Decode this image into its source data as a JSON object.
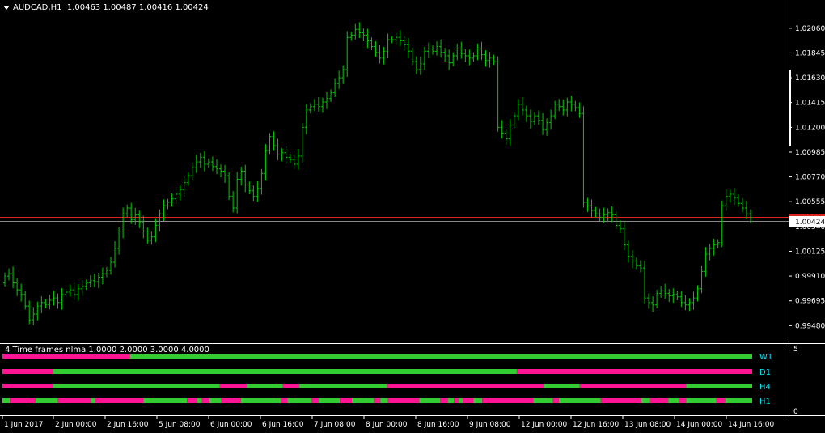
{
  "header": {
    "menu_icon": "triangle-down-icon",
    "symbol": "AUDCAD,H1",
    "ohlc": "1.00463 1.00487 1.00416 1.00424"
  },
  "indicator": {
    "title": "4 Time frames nlma 1.0000 2.0000 3.0000 4.0000",
    "scale_top": "5",
    "scale_bottom": "0",
    "rows": [
      {
        "label": "W1",
        "segments": [
          [
            "m",
            0,
            0.17
          ],
          [
            "g",
            0.17,
            1
          ]
        ]
      },
      {
        "label": "D1",
        "segments": [
          [
            "m",
            0,
            0.068
          ],
          [
            "g",
            0.068,
            0.686
          ],
          [
            "m",
            0.686,
            1
          ]
        ]
      },
      {
        "label": "H4",
        "segments": [
          [
            "m",
            0,
            0.068
          ],
          [
            "g",
            0.068,
            0.29
          ],
          [
            "m",
            0.29,
            0.326
          ],
          [
            "g",
            0.326,
            0.374
          ],
          [
            "m",
            0.374,
            0.396
          ],
          [
            "g",
            0.396,
            0.513
          ],
          [
            "m",
            0.513,
            0.722
          ],
          [
            "g",
            0.722,
            0.77
          ],
          [
            "m",
            0.77,
            0.912
          ],
          [
            "g",
            0.912,
            1
          ]
        ]
      },
      {
        "label": "H1",
        "segments": [
          [
            "g",
            0,
            0.01
          ],
          [
            "m",
            0.01,
            0.044
          ],
          [
            "g",
            0.044,
            0.074
          ],
          [
            "m",
            0.074,
            0.118
          ],
          [
            "g",
            0.118,
            0.124
          ],
          [
            "m",
            0.124,
            0.188
          ],
          [
            "g",
            0.188,
            0.246
          ],
          [
            "m",
            0.246,
            0.26
          ],
          [
            "g",
            0.26,
            0.266
          ],
          [
            "m",
            0.266,
            0.276
          ],
          [
            "g",
            0.276,
            0.292
          ],
          [
            "m",
            0.292,
            0.318
          ],
          [
            "g",
            0.318,
            0.372
          ],
          [
            "m",
            0.372,
            0.38
          ],
          [
            "g",
            0.38,
            0.412
          ],
          [
            "m",
            0.412,
            0.422
          ],
          [
            "g",
            0.422,
            0.45
          ],
          [
            "m",
            0.45,
            0.466
          ],
          [
            "g",
            0.466,
            0.496
          ],
          [
            "m",
            0.496,
            0.504
          ],
          [
            "g",
            0.504,
            0.514
          ],
          [
            "m",
            0.514,
            0.556
          ],
          [
            "g",
            0.556,
            0.584
          ],
          [
            "m",
            0.584,
            0.594
          ],
          [
            "g",
            0.594,
            0.602
          ],
          [
            "m",
            0.602,
            0.608
          ],
          [
            "g",
            0.608,
            0.614
          ],
          [
            "m",
            0.614,
            0.628
          ],
          [
            "g",
            0.628,
            0.64
          ],
          [
            "m",
            0.64,
            0.708
          ],
          [
            "g",
            0.708,
            0.734
          ],
          [
            "m",
            0.734,
            0.742
          ],
          [
            "g",
            0.742,
            0.798
          ],
          [
            "m",
            0.798,
            0.852
          ],
          [
            "g",
            0.852,
            0.864
          ],
          [
            "m",
            0.864,
            0.888
          ],
          [
            "g",
            0.888,
            0.902
          ],
          [
            "m",
            0.902,
            0.912
          ],
          [
            "g",
            0.912,
            0.952
          ],
          [
            "m",
            0.952,
            0.964
          ],
          [
            "g",
            0.964,
            1
          ]
        ]
      }
    ]
  },
  "chart_data": {
    "type": "bar",
    "title": "AUDCAD,H1",
    "ylim": [
      0.9937,
      1.0215
    ],
    "y_ticks": [
      "1.02060",
      "1.01845",
      "1.01630",
      "1.01415",
      "1.01200",
      "1.00985",
      "1.00770",
      "1.00555",
      "1.00340",
      "1.00125",
      "0.99910",
      "0.99695",
      "0.99480"
    ],
    "x_ticks": [
      "1 Jun 2017",
      "2 Jun 00:00",
      "2 Jun 16:00",
      "5 Jun 08:00",
      "6 Jun 00:00",
      "6 Jun 16:00",
      "7 Jun 08:00",
      "8 Jun 00:00",
      "8 Jun 16:00",
      "9 Jun 08:00",
      "12 Jun 00:00",
      "12 Jun 16:00",
      "13 Jun 08:00",
      "14 Jun 00:00",
      "14 Jun 16:00"
    ],
    "current_price": "1.00424",
    "series": [
      {
        "bar_color": "#00cc00",
        "close": [
          0.9991,
          0.9993,
          0.9985,
          0.9979,
          0.9975,
          0.9965,
          0.9953,
          0.9958,
          0.9965,
          0.9968,
          0.9966,
          0.997,
          0.9972,
          0.9968,
          0.9975,
          0.9977,
          0.9979,
          0.9975,
          0.998,
          0.9982,
          0.9985,
          0.9987,
          0.9986,
          0.999,
          0.9993,
          0.9996,
          1.0003,
          1.0015,
          1.003,
          1.0045,
          1.005,
          1.004,
          1.0044,
          1.0038,
          1.003,
          1.0022,
          1.0025,
          1.0035,
          1.0045,
          1.0052,
          1.0055,
          1.0058,
          1.0062,
          1.0066,
          1.0072,
          1.0078,
          1.0085,
          1.009,
          1.0094,
          1.0088,
          1.009,
          1.0086,
          1.0084,
          1.0082,
          1.0078,
          1.006,
          1.005,
          1.0075,
          1.0082,
          1.007,
          1.0065,
          1.006,
          1.0067,
          1.008,
          1.01,
          1.0112,
          1.0104,
          1.0096,
          1.0098,
          1.0094,
          1.0092,
          1.0088,
          1.0095,
          1.012,
          1.0135,
          1.0138,
          1.014,
          1.0138,
          1.0142,
          1.0145,
          1.015,
          1.0158,
          1.0163,
          1.017,
          1.0198,
          1.02,
          1.0205,
          1.0202,
          1.02,
          1.0195,
          1.019,
          1.0185,
          1.018,
          1.0186,
          1.0196,
          1.0196,
          1.0198,
          1.0195,
          1.0192,
          1.0186,
          1.0177,
          1.017,
          1.0175,
          1.0186,
          1.0188,
          1.0186,
          1.019,
          1.0185,
          1.0182,
          1.0176,
          1.0182,
          1.0188,
          1.0184,
          1.0182,
          1.018,
          1.0182,
          1.0188,
          1.0183,
          1.0178,
          1.018,
          1.0177,
          1.012,
          1.0115,
          1.011,
          1.0122,
          1.013,
          1.014,
          1.0135,
          1.013,
          1.0125,
          1.013,
          1.0126,
          1.0118,
          1.0124,
          1.013,
          1.014,
          1.0138,
          1.0135,
          1.0142,
          1.014,
          1.0137,
          1.0132,
          1.0055,
          1.0052,
          1.0048,
          1.0045,
          1.0042,
          1.0044,
          1.0046,
          1.0044,
          1.0035,
          1.0032,
          1.0018,
          1.0008,
          1.0004,
          1.0,
          0.9998,
          0.9972,
          0.9968,
          0.9966,
          0.9976,
          0.9978,
          0.9976,
          0.9974,
          0.9975,
          0.9973,
          0.9968,
          0.9966,
          0.9968,
          0.9972,
          0.998,
          0.9995,
          1.001,
          1.0015,
          1.0018,
          1.002,
          1.0052,
          1.006,
          1.0062,
          1.0059,
          1.0054,
          1.005,
          1.0045,
          1.0042
        ]
      }
    ]
  }
}
